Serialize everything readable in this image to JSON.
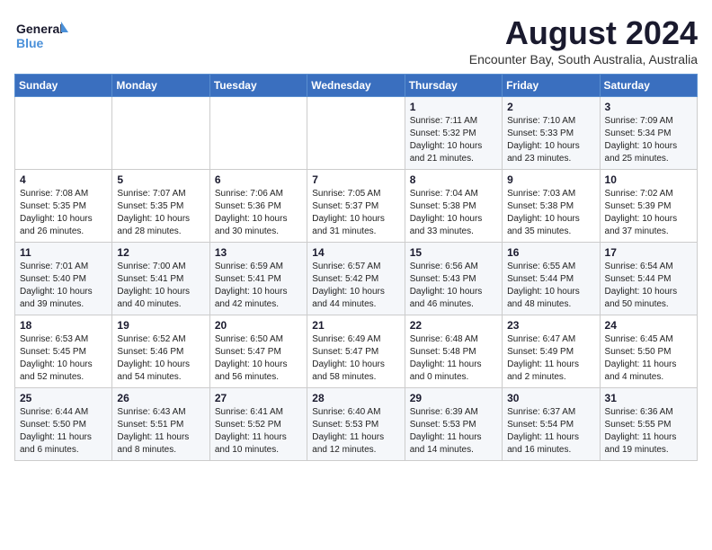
{
  "header": {
    "logo_line1": "General",
    "logo_line2": "Blue",
    "month_title": "August 2024",
    "location": "Encounter Bay, South Australia, Australia"
  },
  "days_of_week": [
    "Sunday",
    "Monday",
    "Tuesday",
    "Wednesday",
    "Thursday",
    "Friday",
    "Saturday"
  ],
  "weeks": [
    [
      {
        "day": "",
        "info": ""
      },
      {
        "day": "",
        "info": ""
      },
      {
        "day": "",
        "info": ""
      },
      {
        "day": "",
        "info": ""
      },
      {
        "day": "1",
        "info": "Sunrise: 7:11 AM\nSunset: 5:32 PM\nDaylight: 10 hours\nand 21 minutes."
      },
      {
        "day": "2",
        "info": "Sunrise: 7:10 AM\nSunset: 5:33 PM\nDaylight: 10 hours\nand 23 minutes."
      },
      {
        "day": "3",
        "info": "Sunrise: 7:09 AM\nSunset: 5:34 PM\nDaylight: 10 hours\nand 25 minutes."
      }
    ],
    [
      {
        "day": "4",
        "info": "Sunrise: 7:08 AM\nSunset: 5:35 PM\nDaylight: 10 hours\nand 26 minutes."
      },
      {
        "day": "5",
        "info": "Sunrise: 7:07 AM\nSunset: 5:35 PM\nDaylight: 10 hours\nand 28 minutes."
      },
      {
        "day": "6",
        "info": "Sunrise: 7:06 AM\nSunset: 5:36 PM\nDaylight: 10 hours\nand 30 minutes."
      },
      {
        "day": "7",
        "info": "Sunrise: 7:05 AM\nSunset: 5:37 PM\nDaylight: 10 hours\nand 31 minutes."
      },
      {
        "day": "8",
        "info": "Sunrise: 7:04 AM\nSunset: 5:38 PM\nDaylight: 10 hours\nand 33 minutes."
      },
      {
        "day": "9",
        "info": "Sunrise: 7:03 AM\nSunset: 5:38 PM\nDaylight: 10 hours\nand 35 minutes."
      },
      {
        "day": "10",
        "info": "Sunrise: 7:02 AM\nSunset: 5:39 PM\nDaylight: 10 hours\nand 37 minutes."
      }
    ],
    [
      {
        "day": "11",
        "info": "Sunrise: 7:01 AM\nSunset: 5:40 PM\nDaylight: 10 hours\nand 39 minutes."
      },
      {
        "day": "12",
        "info": "Sunrise: 7:00 AM\nSunset: 5:41 PM\nDaylight: 10 hours\nand 40 minutes."
      },
      {
        "day": "13",
        "info": "Sunrise: 6:59 AM\nSunset: 5:41 PM\nDaylight: 10 hours\nand 42 minutes."
      },
      {
        "day": "14",
        "info": "Sunrise: 6:57 AM\nSunset: 5:42 PM\nDaylight: 10 hours\nand 44 minutes."
      },
      {
        "day": "15",
        "info": "Sunrise: 6:56 AM\nSunset: 5:43 PM\nDaylight: 10 hours\nand 46 minutes."
      },
      {
        "day": "16",
        "info": "Sunrise: 6:55 AM\nSunset: 5:44 PM\nDaylight: 10 hours\nand 48 minutes."
      },
      {
        "day": "17",
        "info": "Sunrise: 6:54 AM\nSunset: 5:44 PM\nDaylight: 10 hours\nand 50 minutes."
      }
    ],
    [
      {
        "day": "18",
        "info": "Sunrise: 6:53 AM\nSunset: 5:45 PM\nDaylight: 10 hours\nand 52 minutes."
      },
      {
        "day": "19",
        "info": "Sunrise: 6:52 AM\nSunset: 5:46 PM\nDaylight: 10 hours\nand 54 minutes."
      },
      {
        "day": "20",
        "info": "Sunrise: 6:50 AM\nSunset: 5:47 PM\nDaylight: 10 hours\nand 56 minutes."
      },
      {
        "day": "21",
        "info": "Sunrise: 6:49 AM\nSunset: 5:47 PM\nDaylight: 10 hours\nand 58 minutes."
      },
      {
        "day": "22",
        "info": "Sunrise: 6:48 AM\nSunset: 5:48 PM\nDaylight: 11 hours\nand 0 minutes."
      },
      {
        "day": "23",
        "info": "Sunrise: 6:47 AM\nSunset: 5:49 PM\nDaylight: 11 hours\nand 2 minutes."
      },
      {
        "day": "24",
        "info": "Sunrise: 6:45 AM\nSunset: 5:50 PM\nDaylight: 11 hours\nand 4 minutes."
      }
    ],
    [
      {
        "day": "25",
        "info": "Sunrise: 6:44 AM\nSunset: 5:50 PM\nDaylight: 11 hours\nand 6 minutes."
      },
      {
        "day": "26",
        "info": "Sunrise: 6:43 AM\nSunset: 5:51 PM\nDaylight: 11 hours\nand 8 minutes."
      },
      {
        "day": "27",
        "info": "Sunrise: 6:41 AM\nSunset: 5:52 PM\nDaylight: 11 hours\nand 10 minutes."
      },
      {
        "day": "28",
        "info": "Sunrise: 6:40 AM\nSunset: 5:53 PM\nDaylight: 11 hours\nand 12 minutes."
      },
      {
        "day": "29",
        "info": "Sunrise: 6:39 AM\nSunset: 5:53 PM\nDaylight: 11 hours\nand 14 minutes."
      },
      {
        "day": "30",
        "info": "Sunrise: 6:37 AM\nSunset: 5:54 PM\nDaylight: 11 hours\nand 16 minutes."
      },
      {
        "day": "31",
        "info": "Sunrise: 6:36 AM\nSunset: 5:55 PM\nDaylight: 11 hours\nand 19 minutes."
      }
    ]
  ]
}
